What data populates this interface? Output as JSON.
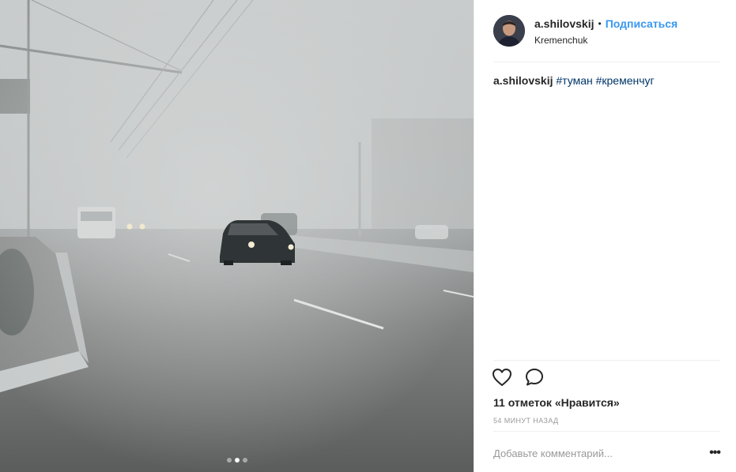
{
  "post": {
    "author": {
      "username": "a.shilovskij",
      "separator": "•",
      "follow_label": "Подписаться",
      "location": "Kremenchuk"
    },
    "caption": {
      "username": "a.shilovskij",
      "hashtags": [
        "#туман",
        "#кременчуг"
      ]
    },
    "likes_text": "11 отметок «Нравится»",
    "time_text": "54 МИНУТ НАЗАД",
    "comment": {
      "placeholder": "Добавьте комментарий...",
      "value": ""
    },
    "more_label": "•••",
    "carousel": {
      "count": 3,
      "active_index": 1
    },
    "icons": {
      "like": "heart-outline-icon",
      "comment": "speech-bubble-icon",
      "more": "more-options-icon"
    },
    "colors": {
      "link_blue": "#3897f0",
      "hashtag_blue": "#003569",
      "text": "#262626",
      "muted": "#999999",
      "divider": "#efefef"
    }
  }
}
